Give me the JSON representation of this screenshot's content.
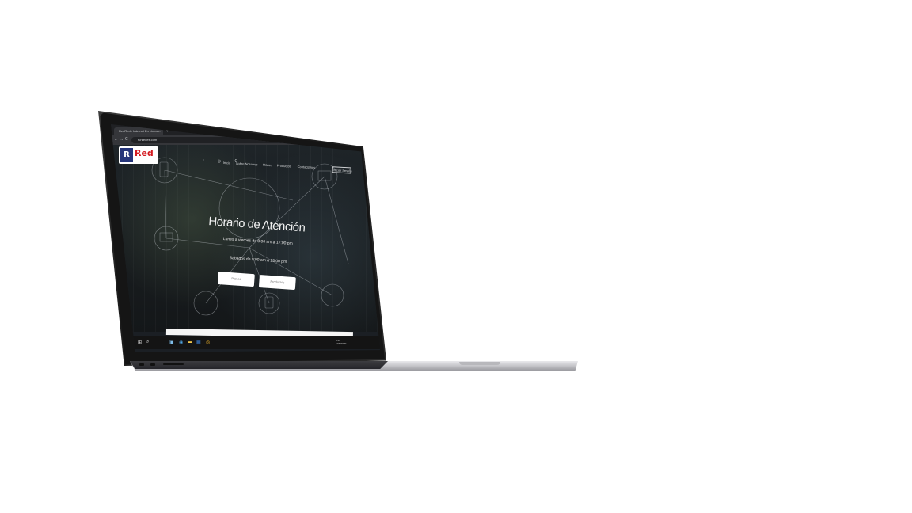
{
  "browser": {
    "tab_title": "RedRed - Internet En Lineas",
    "tab_close": "×",
    "new_tab": "+",
    "url": "funredes.com",
    "back": "←",
    "forward": "→",
    "reload": "C"
  },
  "site": {
    "logo_letter": "R",
    "logo_red": "Red",
    "nav": {
      "inicio": "Inicio",
      "sobre": "Sobre Nosotros",
      "planes": "Planes",
      "productos": "Productos",
      "contactanos": "Contactanos",
      "login": "Iniciar Sesión"
    },
    "hero": {
      "title": "Horario de Atención",
      "line1": "Lunes a viernes de 8:00 am a 17:00 pm",
      "line2": "Sabados de 9:00 am a 13:00 pm",
      "btn_planes": "Planes",
      "btn_productos": "Productos"
    }
  },
  "taskbar": {
    "start": "⊞",
    "search": "⌕",
    "clock_time": "9:51",
    "clock_date": "10/6/2020"
  },
  "colors": {
    "logo_blue": "#26357a",
    "logo_red": "#d41b21",
    "chrome_dark": "#202124"
  }
}
